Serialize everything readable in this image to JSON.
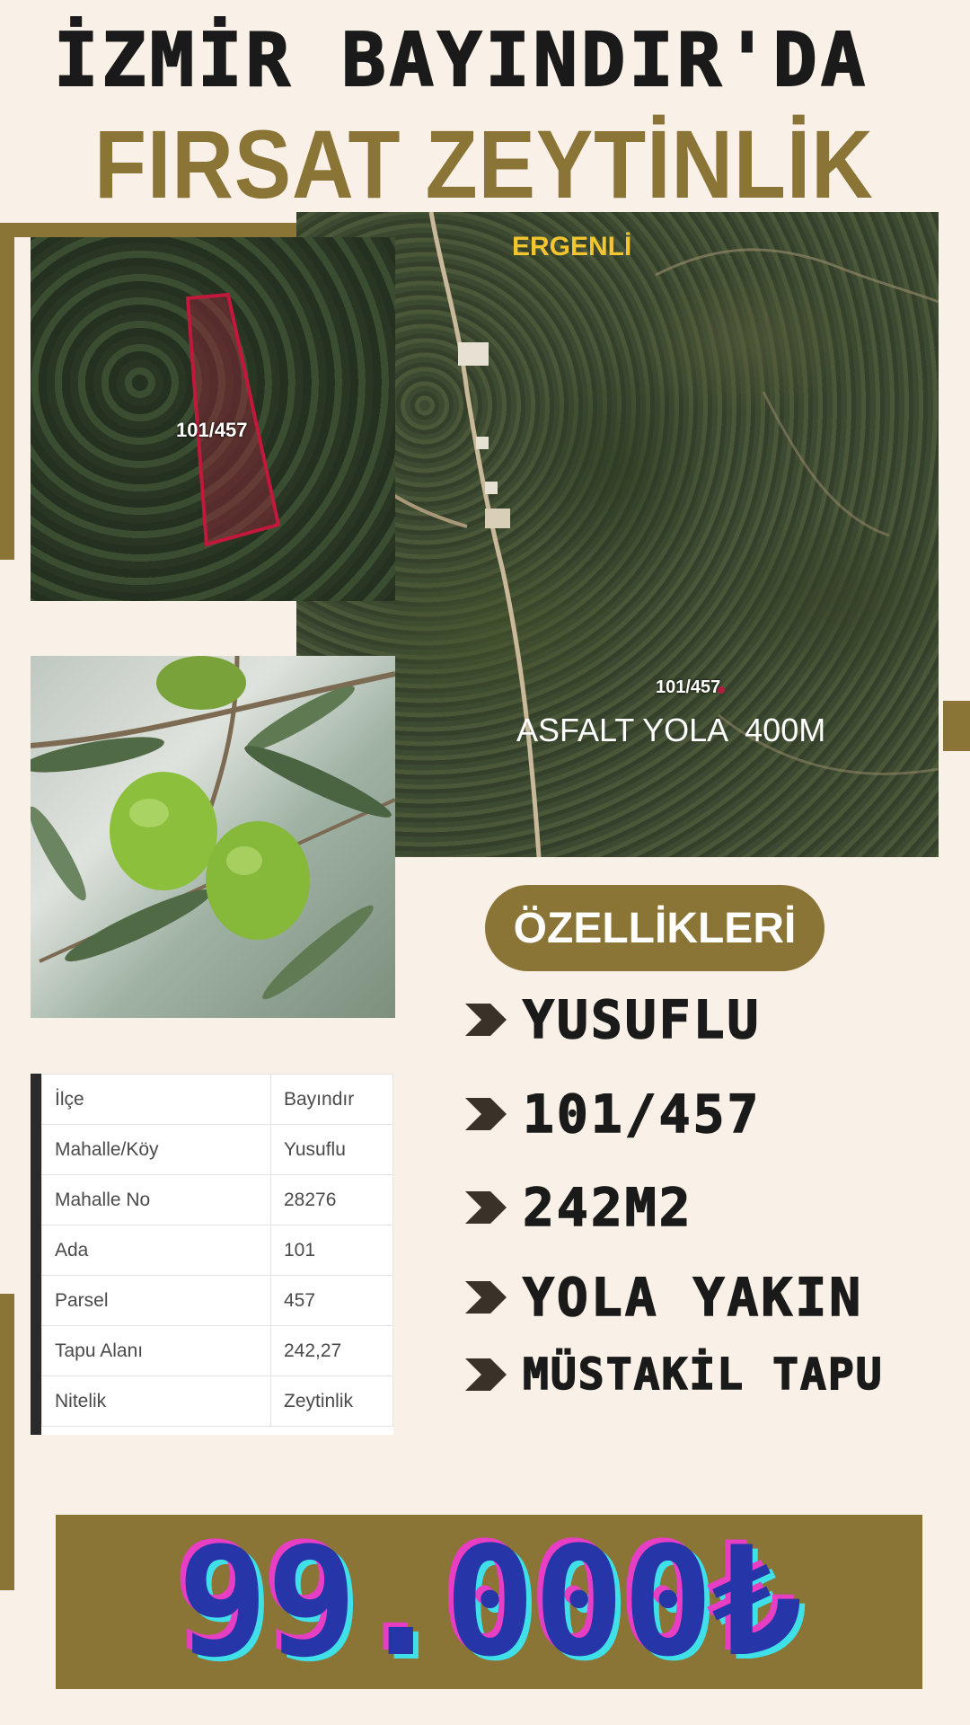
{
  "header": {
    "line1": "İZMİR BAYINDIR'DA",
    "line2": "FIRSAT ZEYTİNLİK"
  },
  "map": {
    "village_label": "ERGENLİ",
    "parcel_label": "101/457",
    "road_label": "ASFALT YOLA  400M"
  },
  "zoom_map": {
    "parcel_label": "101/457"
  },
  "features": {
    "title": "ÖZELLİKLERİ",
    "items": [
      "YUSUFLU",
      "101/457",
      "242M2",
      "YOLA YAKIN",
      "MÜSTAKİL TAPU"
    ]
  },
  "table": {
    "rows": [
      {
        "key": "İlçe",
        "value": "Bayındır"
      },
      {
        "key": "Mahalle/Köy",
        "value": "Yusuflu"
      },
      {
        "key": "Mahalle No",
        "value": "28276"
      },
      {
        "key": "Ada",
        "value": "101"
      },
      {
        "key": "Parsel",
        "value": "457"
      },
      {
        "key": "Tapu Alanı",
        "value": "242,27"
      },
      {
        "key": "Nitelik",
        "value": "Zeytinlik"
      }
    ]
  },
  "price": "99.000₺",
  "colors": {
    "background": "#f9f1e8",
    "accent": "#8a7436",
    "price_text": "#2636a8",
    "village_label": "#f2c531"
  }
}
